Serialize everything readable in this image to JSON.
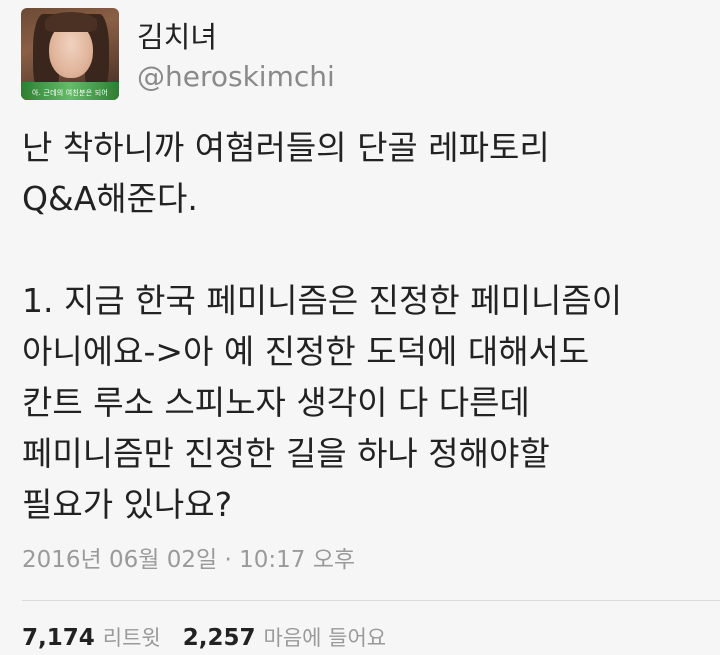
{
  "profile": {
    "display_name": "김치녀",
    "handle": "@heroskimchi",
    "avatar_caption": "아. 근데의 여친분은 되어"
  },
  "tweet": {
    "text": "난 착하니까 여혐러들의 단골 레파토리\nQ&A해준다.\n\n1. 지금 한국 페미니즘은 진정한 페미니즘이\n아니에요->아 예 진정한 도덕에 대해서도\n칸트 루소 스피노자 생각이 다 다른데\n페미니즘만 진정한 길을 하나 정해야할\n필요가 있나요?",
    "timestamp": "2016년 06월 02일 · 10:17 오후"
  },
  "stats": {
    "retweets_count": "7,174",
    "retweets_label": "리트윗",
    "likes_count": "2,257",
    "likes_label": "마음에 들어요"
  },
  "colors": {
    "background": "#f6f6f6",
    "text": "#222222",
    "muted": "#9a9a9a"
  }
}
